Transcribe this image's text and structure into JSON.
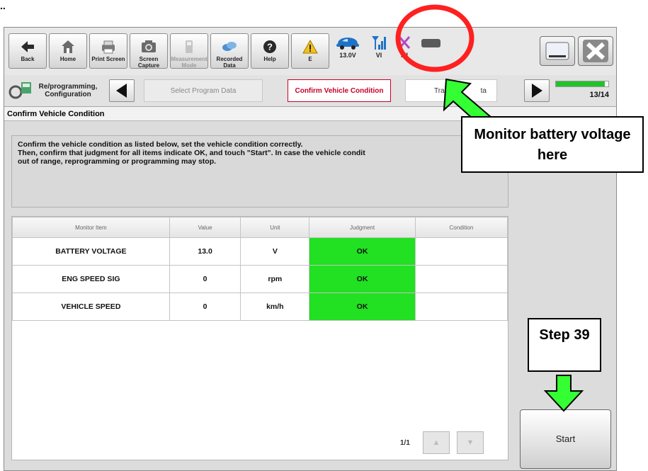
{
  "page_marker": "..",
  "toolbar": {
    "buttons": [
      {
        "label": "Back",
        "icon": "back-arrow-icon"
      },
      {
        "label": "Home",
        "icon": "home-icon"
      },
      {
        "label": "Print Screen",
        "icon": "printer-icon"
      },
      {
        "label": "Screen Capture",
        "icon": "camera-icon"
      },
      {
        "label": "Measurement Mode",
        "icon": "meter-icon"
      },
      {
        "label": "Recorded Data",
        "icon": "recorded-data-icon"
      },
      {
        "label": "Help",
        "icon": "help-icon"
      },
      {
        "label": "E",
        "icon": "warning-icon"
      }
    ],
    "status": {
      "voltage": "13.0V",
      "vi": "VI",
      "mi": "MI"
    }
  },
  "nav": {
    "section_label": "Re/programming, Configuration",
    "steps": [
      "Select Program Data",
      "Confirm Vehicle Condition",
      "Trans",
      "ta"
    ],
    "progress": "13/14",
    "progress_fraction": 0.93
  },
  "content": {
    "title": "Confirm Vehicle Condition",
    "instructions": [
      "Confirm the vehicle condition as listed below, set the vehicle condition correctly.",
      "Then, confirm that judgment for all items indicate OK, and touch \"Start\". In case the vehicle condit",
      "out of range, reprogramming or programming may stop."
    ],
    "table": {
      "headers": [
        "Monitor Item",
        "Value",
        "Unit",
        "Judgment",
        "Condition"
      ],
      "rows": [
        {
          "item": "BATTERY VOLTAGE",
          "value": "13.0",
          "unit": "V",
          "judgment": "OK",
          "condition": ""
        },
        {
          "item": "ENG SPEED SIG",
          "value": "0",
          "unit": "rpm",
          "judgment": "OK",
          "condition": ""
        },
        {
          "item": "VEHICLE SPEED",
          "value": "0",
          "unit": "km/h",
          "judgment": "OK",
          "condition": ""
        }
      ]
    },
    "pager": "1/1",
    "start_label": "Start"
  },
  "annotations": {
    "battery_callout": "Monitor battery voltage here",
    "step_callout": "Step 39"
  },
  "colors": {
    "ok_green": "#22e022",
    "highlight_red": "#ff2020",
    "arrow_green": "#33ff33",
    "active_step": "#c8002a"
  }
}
